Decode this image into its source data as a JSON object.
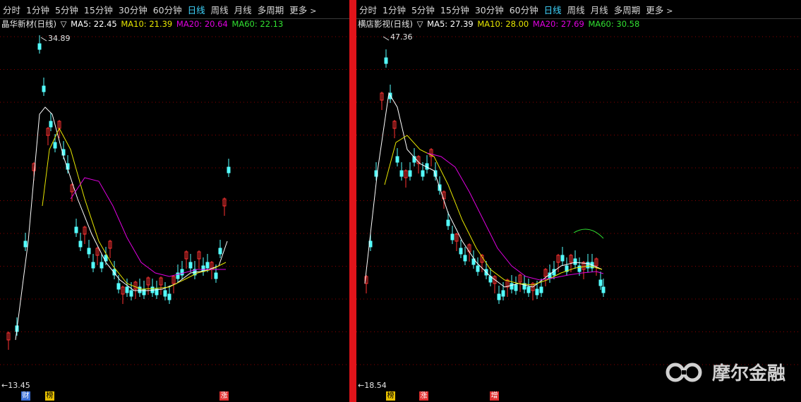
{
  "tabs": [
    "分时",
    "1分钟",
    "5分钟",
    "15分钟",
    "30分钟",
    "60分钟",
    "日线",
    "周线",
    "月线",
    "多周期",
    "更多"
  ],
  "active_tab": "日线",
  "left": {
    "name": "晶华新材(日线)",
    "ma5": "MA5: 22.45",
    "ma10": "MA10: 21.39",
    "ma20": "MA20: 20.64",
    "ma60": "MA60: 22.13",
    "high_label": "34.89",
    "low_label": "13.45",
    "tags": [
      "财",
      "榜",
      "涨"
    ]
  },
  "right": {
    "name": "横店影视(日线)",
    "ma5": "MA5: 27.39",
    "ma10": "MA10: 28.00",
    "ma20": "MA20: 27.69",
    "ma60": "MA60: 30.58",
    "high_label": "47.36",
    "low_label": "18.54",
    "tags": [
      "榜",
      "涨",
      "增"
    ]
  },
  "colors": {
    "up": "#ff3232",
    "down": "#54ffff",
    "ma5": "#ffffff",
    "ma10": "#e6e600",
    "ma20": "#e000e0",
    "ma60": "#31e031",
    "grid": "#8b0000",
    "active_tab": "#3fd6ff",
    "divider": "#e0141a"
  },
  "watermark": "摩尔金融"
}
